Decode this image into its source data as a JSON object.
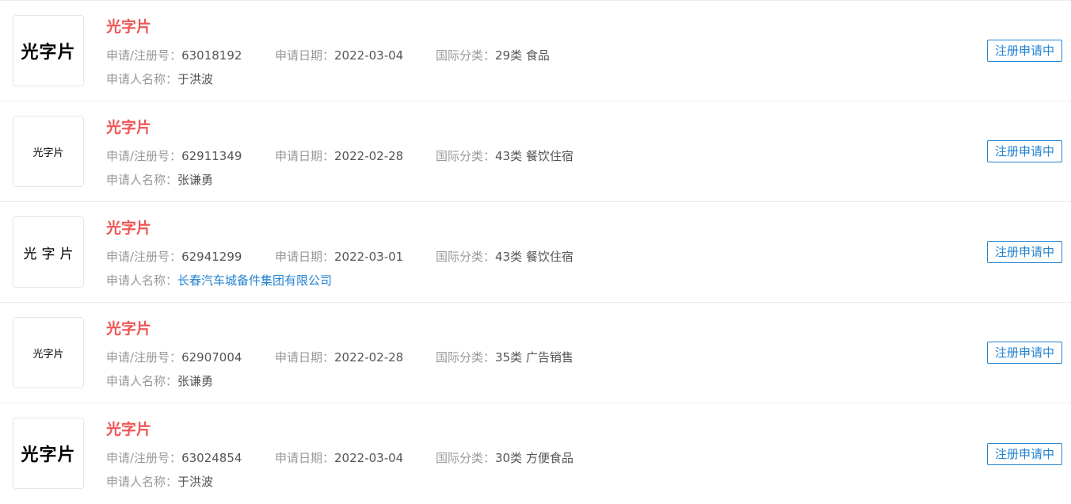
{
  "labels": {
    "reg_no": "申请/注册号：",
    "apply_date": "申请日期：",
    "intl_class": "国际分类：",
    "applicant": "申请人名称："
  },
  "colors": {
    "title_red": "#f05656",
    "link_blue": "#2383d1",
    "label_gray": "#999999",
    "value_gray": "#555555"
  },
  "trademarks": [
    {
      "logo_text": "光字片",
      "name": "光字片",
      "reg_no": "63018192",
      "apply_date": "2022-03-04",
      "intl_class": "29类 食品",
      "applicant": "于洪波",
      "status": "注册申请中"
    },
    {
      "logo_text": "光字片",
      "name": "光字片",
      "reg_no": "62911349",
      "apply_date": "2022-02-28",
      "intl_class": "43类 餐饮住宿",
      "applicant": "张谦勇",
      "status": "注册申请中"
    },
    {
      "logo_text": "光字片",
      "name": "光字片",
      "reg_no": "62941299",
      "apply_date": "2022-03-01",
      "intl_class": "43类 餐饮住宿",
      "applicant": "长春汽车城备件集团有限公司",
      "status": "注册申请中"
    },
    {
      "logo_text": "光字片",
      "name": "光字片",
      "reg_no": "62907004",
      "apply_date": "2022-02-28",
      "intl_class": "35类 广告销售",
      "applicant": "张谦勇",
      "status": "注册申请中"
    },
    {
      "logo_text": "光字片",
      "name": "光字片",
      "reg_no": "63024854",
      "apply_date": "2022-03-04",
      "intl_class": "30类 方便食品",
      "applicant": "于洪波",
      "status": "注册申请中"
    }
  ]
}
